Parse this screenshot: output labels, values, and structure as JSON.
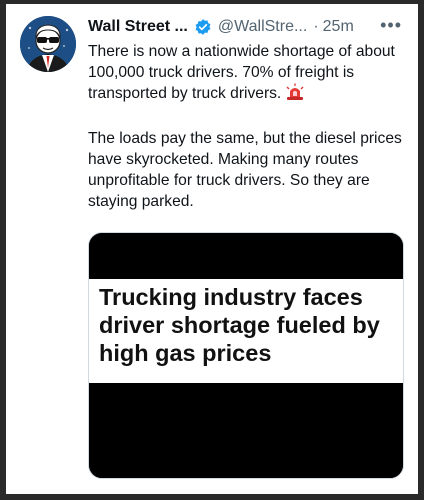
{
  "tweet": {
    "author_name": "Wall Street ...",
    "handle": "@WallStre...",
    "separator": "·",
    "time": "25m",
    "more_label": "•••",
    "paragraphs": [
      "There is now a nationwide shortage of about 100,000 truck drivers. 70% of freight is transported by truck drivers.",
      "The loads pay the same, but the diesel prices have skyrocketed. Making many routes unprofitable for truck drivers. So they are staying parked."
    ],
    "emoji_icon": "police-siren-icon",
    "verified_icon": "verified-badge-icon"
  },
  "card": {
    "headline": "Trucking industry faces driver shortage fueled by high gas prices"
  },
  "colors": {
    "text_primary": "#0f1419",
    "text_secondary": "#536471",
    "verified_blue": "#1d9bf0",
    "avatar_bg": "#1d4f86"
  }
}
